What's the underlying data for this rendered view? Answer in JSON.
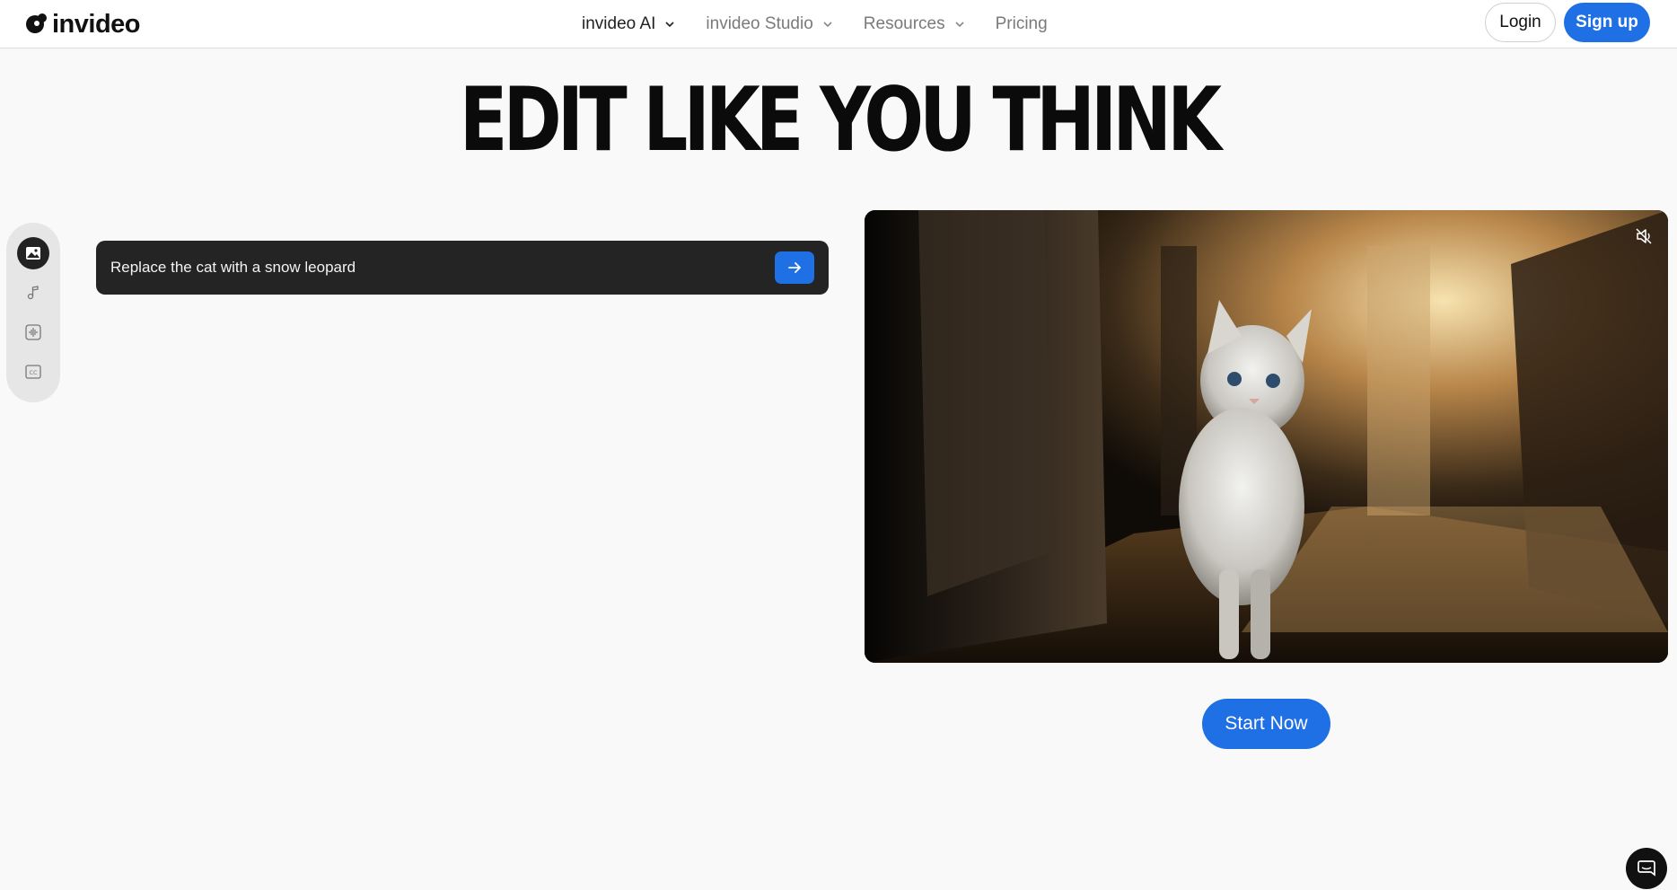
{
  "brand": {
    "name": "invideo",
    "color": "#1f6fe5"
  },
  "nav": {
    "items": [
      {
        "label": "invideo AI",
        "has_dropdown": true,
        "active": true
      },
      {
        "label": "invideo Studio",
        "has_dropdown": true,
        "active": false
      },
      {
        "label": "Resources",
        "has_dropdown": true,
        "active": false
      },
      {
        "label": "Pricing",
        "has_dropdown": false,
        "active": false
      }
    ]
  },
  "header": {
    "login_label": "Login",
    "signup_label": "Sign up"
  },
  "hero": {
    "headline": "EDIT LIKE YOU THINK"
  },
  "tools": [
    {
      "icon": "image-icon",
      "active": true
    },
    {
      "icon": "music-icon",
      "active": false
    },
    {
      "icon": "audio-wave-icon",
      "active": false
    },
    {
      "icon": "captions-icon",
      "active": false
    }
  ],
  "prompt": {
    "text": "Replace the cat with a snow leopard",
    "send_icon": "arrow-right-icon"
  },
  "video": {
    "muted": true,
    "mute_icon": "volume-muted-icon",
    "subject": "white cat walking in ancient temple"
  },
  "cta": {
    "start_label": "Start Now"
  },
  "chat": {
    "icon": "chat-icon"
  }
}
